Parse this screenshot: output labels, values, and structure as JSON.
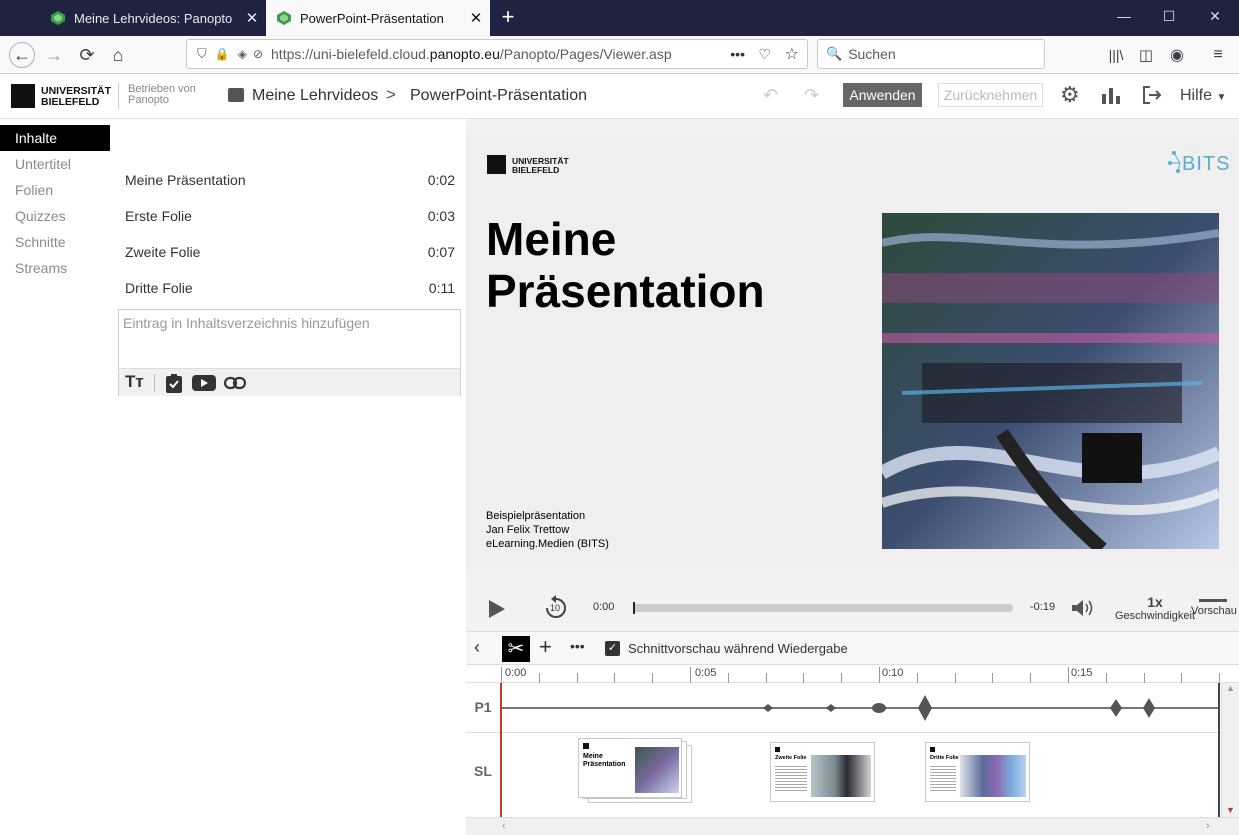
{
  "browser": {
    "tabs": [
      {
        "title": "Meine Lehrvideos: Panopto",
        "active": false
      },
      {
        "title": "PowerPoint-Präsentation",
        "active": true
      }
    ],
    "url": "https://uni-bielefeld.cloud.panopto.eu/Panopto/Pages/Viewer.aspx",
    "url_host_pre": "https://uni-bielefeld.cloud.",
    "url_host_main": "panopto.eu",
    "url_path": "/Panopto/Pages/Viewer.asp",
    "search_placeholder": "Suchen"
  },
  "header": {
    "logo_line1": "UNIVERSITÄT",
    "logo_line2": "BIELEFELD",
    "powered_line1": "Betrieben von",
    "powered_line2": "Panopto",
    "breadcrumb_folder": "Meine Lehrvideos",
    "breadcrumb_sep": ">",
    "breadcrumb_current": "PowerPoint-Präsentation",
    "apply_label": "Anwenden",
    "revert_label": "Zurücknehmen",
    "help_label": "Hilfe"
  },
  "sidebar": {
    "items": [
      {
        "label": "Inhalte",
        "active": true
      },
      {
        "label": "Untertitel"
      },
      {
        "label": "Folien"
      },
      {
        "label": "Quizzes"
      },
      {
        "label": "Schnitte"
      },
      {
        "label": "Streams"
      }
    ]
  },
  "contents": {
    "entries": [
      {
        "title": "Meine Präsentation",
        "time": "0:02"
      },
      {
        "title": "Erste Folie",
        "time": "0:03"
      },
      {
        "title": "Zweite Folie",
        "time": "0:07"
      },
      {
        "title": "Dritte Folie",
        "time": "0:11"
      }
    ],
    "add_placeholder": "Eintrag in Inhaltsverzeichnis hinzufügen"
  },
  "slide": {
    "logo_line1": "UNIVERSITÄT",
    "logo_line2": "BIELEFELD",
    "bits_label": "BITS",
    "title_line1": "Meine",
    "title_line2": "Präsentation",
    "footer_line1": "Beispielpräsentation",
    "footer_line2": "Jan Felix Trettow",
    "footer_line3": "eLearning.Medien  (BITS)"
  },
  "player": {
    "current_time": "0:00",
    "remaining_time": "-0:19",
    "progress": 0,
    "speed_value": "1x",
    "speed_label": "Geschwindigkeit",
    "preview_label": "Vorschau"
  },
  "editor": {
    "preview_checkbox_label": "Schnittvorschau während Wiedergabe",
    "preview_checked": true,
    "ruler_labels": [
      "0:00",
      "0:05",
      "0:10",
      "0:15"
    ],
    "track_labels": [
      "P1",
      "SL"
    ],
    "thumbnails": [
      {
        "title_line1": "Meine",
        "title_line2": "Präsentation"
      },
      {
        "title_line1": "Zweite Folie",
        "title_line2": ""
      },
      {
        "title_line1": "Dritte Folie",
        "title_line2": ""
      }
    ]
  },
  "colors": {
    "tabbar_bg": "#202340",
    "header_text": "#333333",
    "accent_active": "#000000",
    "apply_button": "#666666",
    "playhead": "#c0392b"
  }
}
